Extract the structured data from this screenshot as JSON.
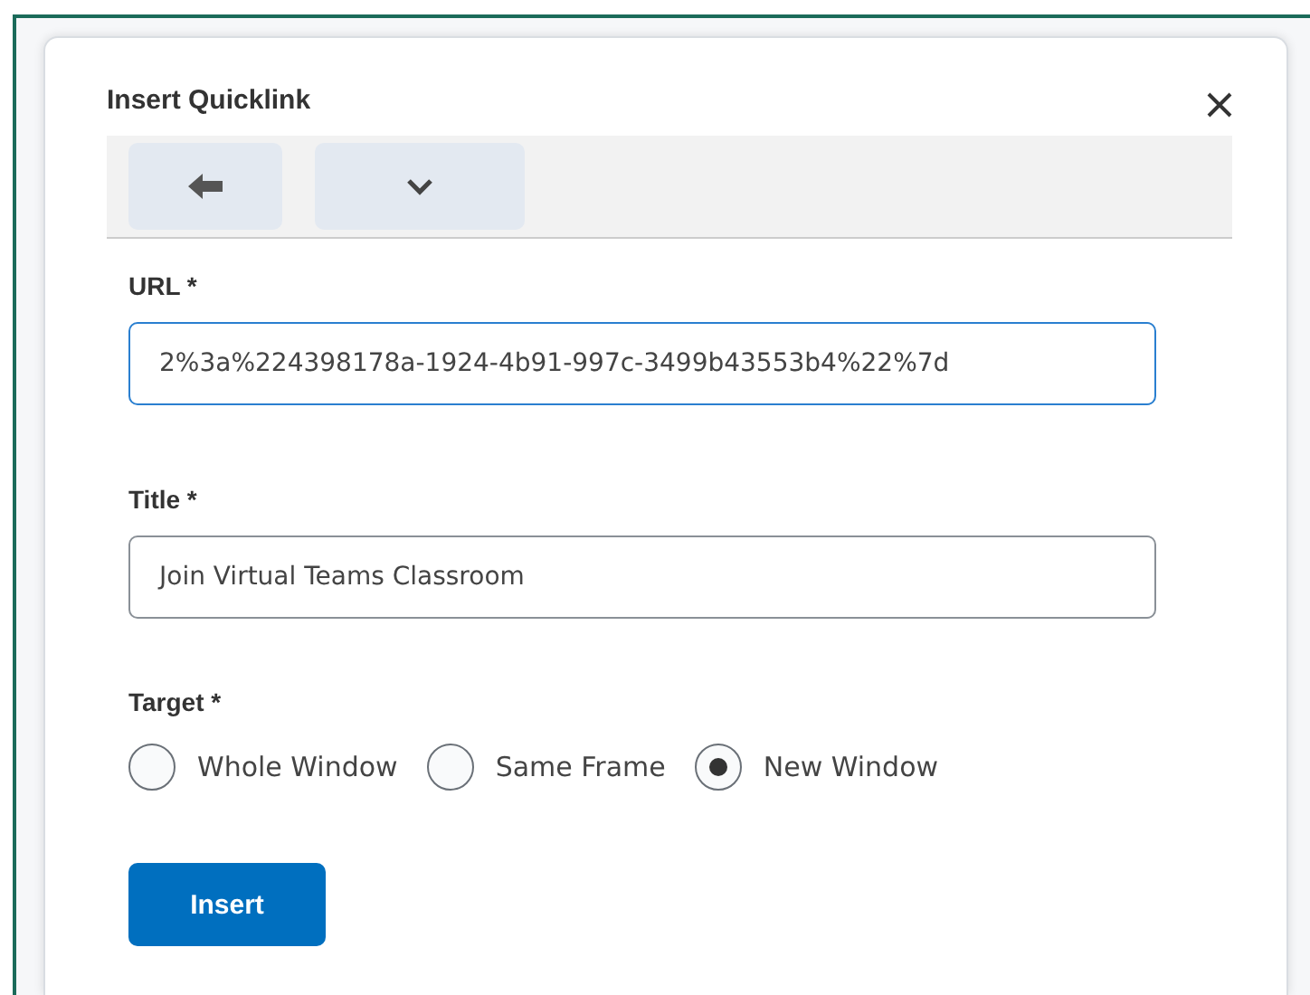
{
  "dialog": {
    "title": "Insert Quicklink",
    "toolbar": {
      "buttons": [
        {
          "kind": "back"
        },
        {
          "kind": "dropdown"
        }
      ]
    },
    "url": {
      "label": "URL *",
      "value": "2%3a%224398178a-1924-4b91-997c-3499b43553b4%22%7d"
    },
    "title_field": {
      "label": "Title *",
      "value": "Join Virtual Teams Classroom"
    },
    "target": {
      "label": "Target *",
      "options": [
        {
          "label": "Whole Window",
          "selected": false
        },
        {
          "label": "Same Frame",
          "selected": false
        },
        {
          "label": "New Window",
          "selected": true
        }
      ]
    },
    "button": "Insert"
  }
}
